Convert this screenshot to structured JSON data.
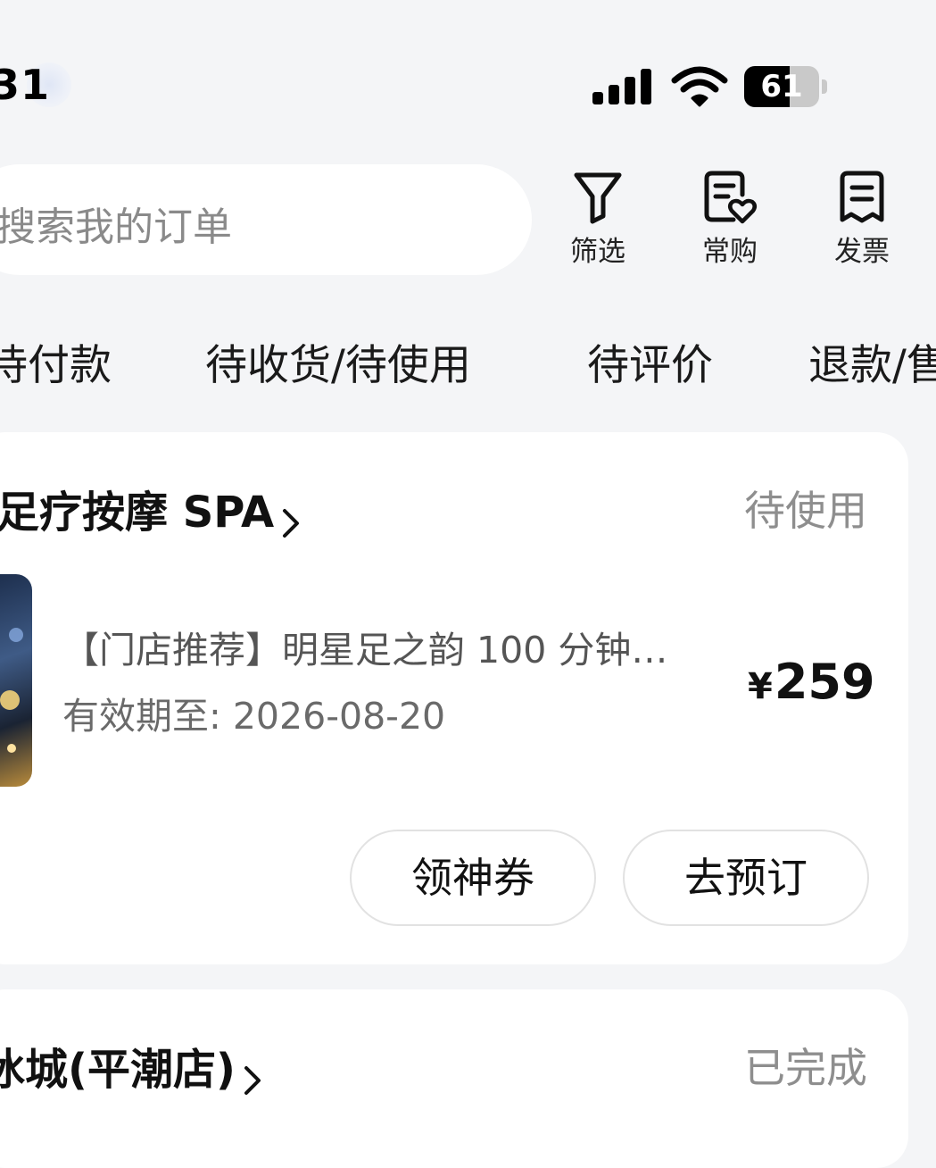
{
  "status_bar": {
    "time": "31",
    "battery_percent": "61",
    "battery_level": 0.61,
    "signal_bars": 4
  },
  "search": {
    "placeholder": "搜索我的订单"
  },
  "toolbar": {
    "filter_label": "筛选",
    "frequent_label": "常购",
    "invoice_label": "发票"
  },
  "tabs": [
    {
      "label": "待付款"
    },
    {
      "label": "待收货/待使用"
    },
    {
      "label": "待评价"
    },
    {
      "label": "退款/售"
    }
  ],
  "orders": [
    {
      "shop": "足疗按摩 SPA",
      "status": "待使用",
      "item_title": "【门店推荐】明星足之韵 100 分钟…",
      "valid_until": "有效期至: 2026-08-20",
      "price_currency": "¥",
      "price_value": "259",
      "buttons": {
        "coupon": "领神券",
        "reserve": "去预订"
      }
    },
    {
      "shop": "冰城(平潮店)",
      "status": "已完成"
    }
  ],
  "colors": {
    "background": "#f4f5f7",
    "card": "#ffffff",
    "muted_text": "#8e8e8e"
  }
}
